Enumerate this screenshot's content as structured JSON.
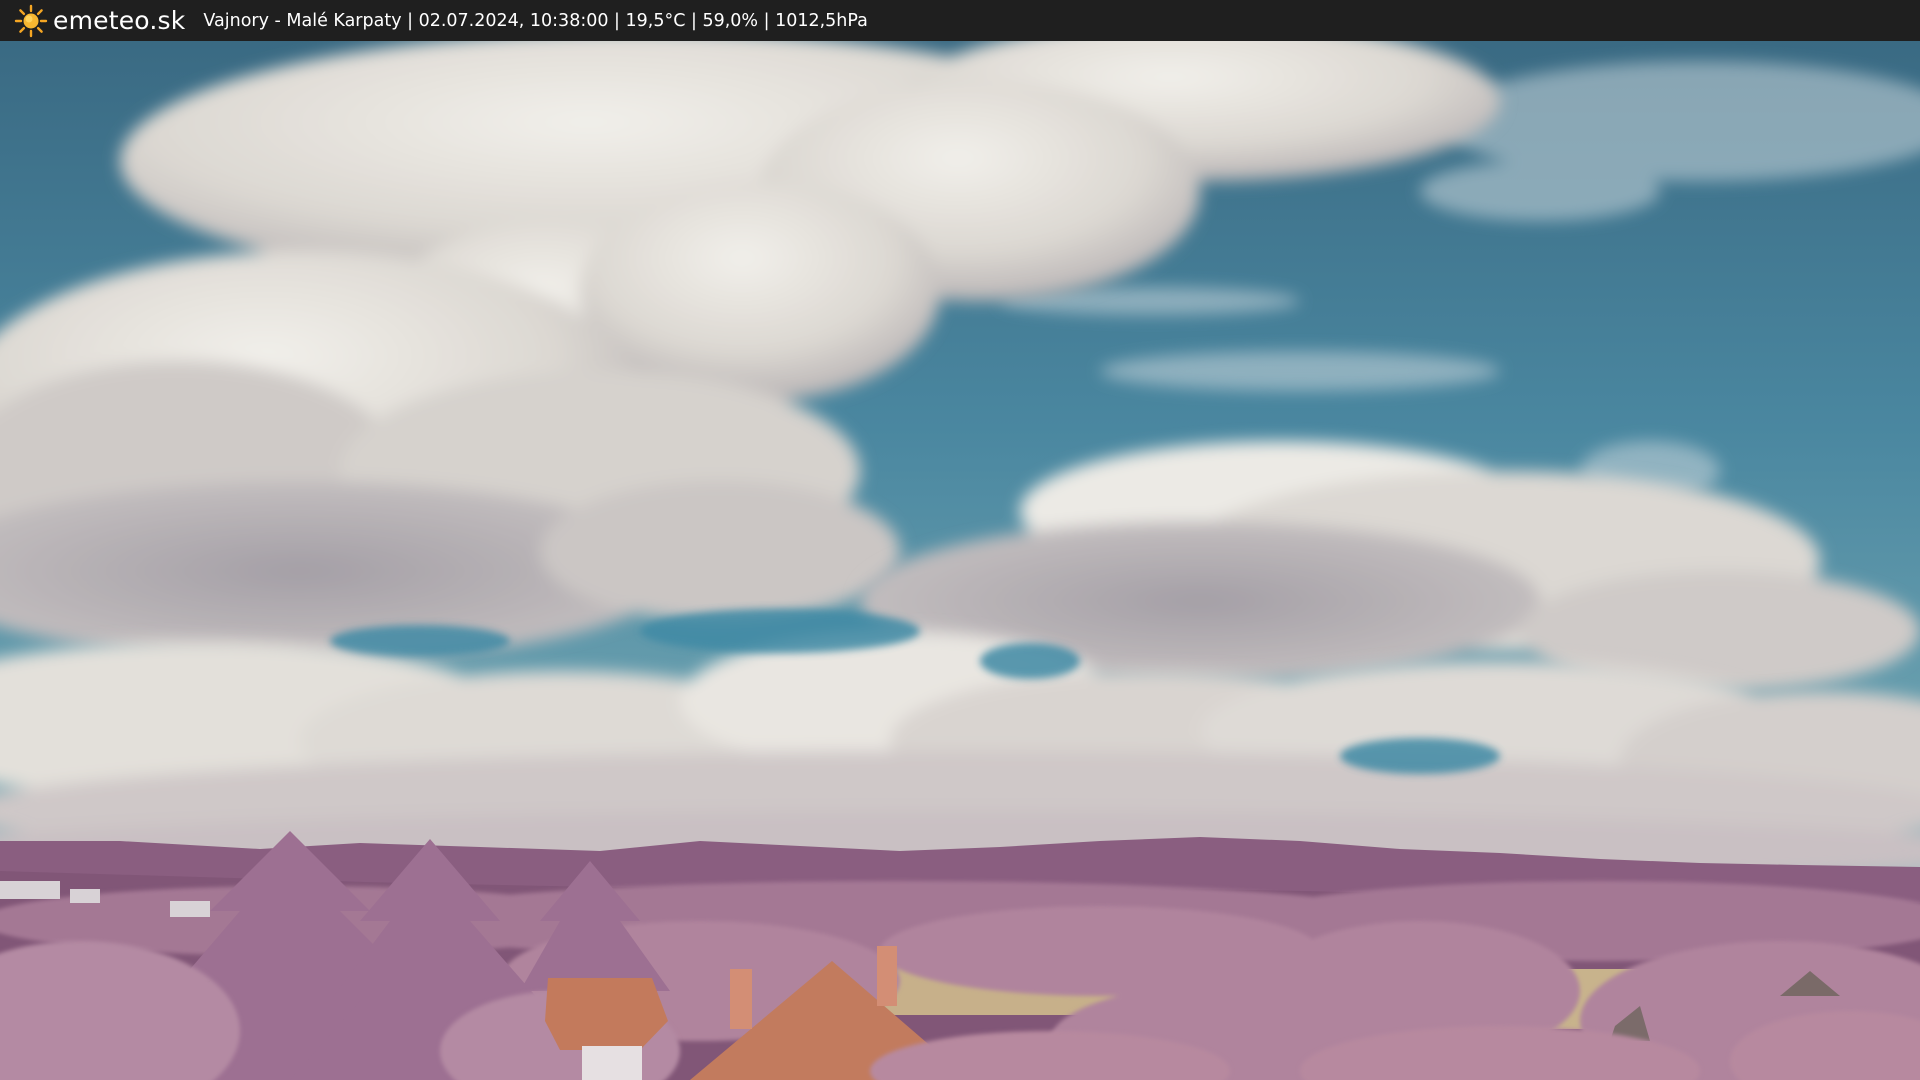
{
  "header": {
    "brand": "emeteo.sk",
    "logo_icon": "sun-icon",
    "info": "Vajnory - Malé Karpaty | 02.07.2024, 10:38:00 | 19,5°C | 59,0% | 1012,5hPa"
  },
  "colors": {
    "bar": "#1f1f1f",
    "sun": "#f5a623",
    "sky_top": "#3c6f86",
    "sky_mid": "#4d8ba3",
    "cloud": "#e7e4dd",
    "cloud_shadow": "#a9a1a6",
    "hills": "#8b5f80",
    "foliage": "#b0849d",
    "roof": "#c0765a",
    "field": "#c8b38c"
  }
}
